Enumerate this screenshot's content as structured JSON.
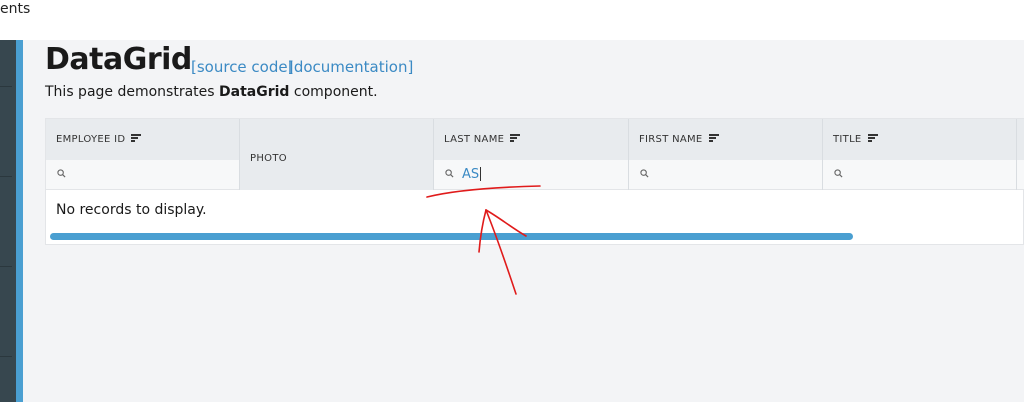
{
  "topbar": {
    "text": "ents"
  },
  "page": {
    "title": "DataGrid",
    "source_link": "[source code]",
    "doc_link": "[documentation]",
    "desc_prefix": "This page demonstrates ",
    "desc_bold": "DataGrid",
    "desc_suffix": " component."
  },
  "grid": {
    "columns": [
      {
        "label": "EMPLOYEE ID",
        "filter": ""
      },
      {
        "label": "PHOTO"
      },
      {
        "label": "LAST NAME",
        "filter": "AS"
      },
      {
        "label": "FIRST NAME",
        "filter": ""
      },
      {
        "label": "TITLE",
        "filter": ""
      }
    ],
    "empty_text": "No records to display."
  },
  "colors": {
    "accent": "#4a9fd1",
    "link": "#3b8ac4",
    "annotation": "#e01b1b"
  }
}
